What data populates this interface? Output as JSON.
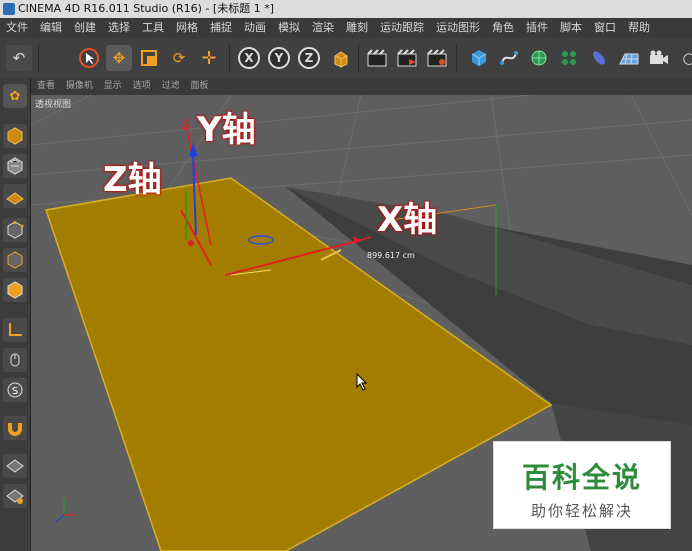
{
  "window": {
    "title": "CINEMA 4D R16.011 Studio (R16) - [未标题 1 *]"
  },
  "menubar": {
    "items": [
      "文件",
      "编辑",
      "创建",
      "选择",
      "工具",
      "网格",
      "捕捉",
      "动画",
      "模拟",
      "渲染",
      "雕刻",
      "运动跟踪",
      "运动图形",
      "角色",
      "插件",
      "脚本",
      "窗口",
      "帮助"
    ]
  },
  "toolbar": {
    "axis_x": "X",
    "axis_y": "Y",
    "axis_z": "Z"
  },
  "viewport": {
    "menu": [
      "查看",
      "摄像机",
      "显示",
      "选项",
      "过滤",
      "面板"
    ],
    "label": "透视视图",
    "measure": "899.617 cm",
    "annotations": {
      "y": "Y轴",
      "z": "Z轴",
      "x": "X轴"
    }
  },
  "watermark": {
    "title": "百科全说",
    "subtitle": "助你轻松解决"
  },
  "colors": {
    "plane": "#a37d00",
    "accent": "#f0a020",
    "axis_x": "#e02020",
    "axis_y": "#2040e0",
    "axis_z": "#20a020"
  }
}
